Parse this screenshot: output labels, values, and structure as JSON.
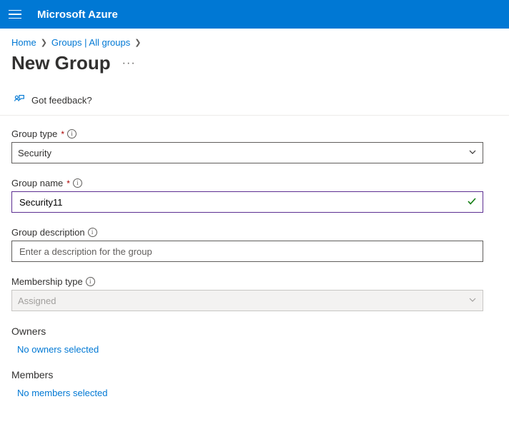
{
  "header": {
    "brand": "Microsoft Azure"
  },
  "breadcrumb": {
    "items": [
      "Home",
      "Groups | All groups"
    ]
  },
  "page": {
    "title": "New Group",
    "feedback_label": "Got feedback?"
  },
  "form": {
    "group_type": {
      "label": "Group type",
      "required": true,
      "value": "Security"
    },
    "group_name": {
      "label": "Group name",
      "required": true,
      "value": "Security11"
    },
    "group_description": {
      "label": "Group description",
      "required": false,
      "placeholder": "Enter a description for the group",
      "value": ""
    },
    "membership_type": {
      "label": "Membership type",
      "required": false,
      "value": "Assigned",
      "disabled": true
    },
    "owners": {
      "heading": "Owners",
      "action": "No owners selected"
    },
    "members": {
      "heading": "Members",
      "action": "No members selected"
    }
  }
}
